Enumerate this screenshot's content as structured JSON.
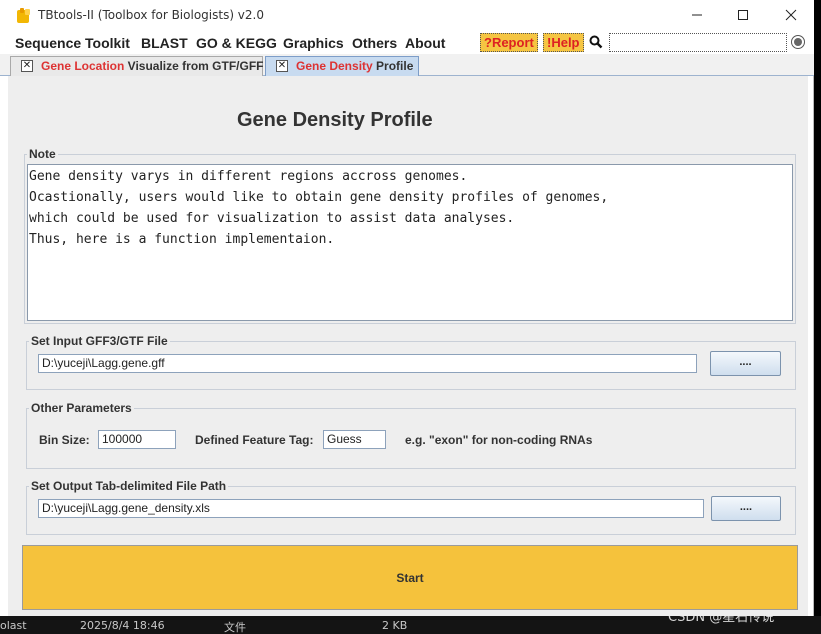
{
  "window": {
    "title": "TBtools-II (Toolbox for Biologists) v2.0",
    "icon": "tbtools-app-icon",
    "minimize_label": "—",
    "maximize_label": "☐",
    "close_label": "✕"
  },
  "menubar": {
    "items": [
      "Sequence Toolkit",
      "BLAST",
      "GO & KEGG",
      "Graphics",
      "Others",
      "About"
    ],
    "report_label": "?Report",
    "help_label": "!Help",
    "search_icon": "search-icon",
    "search_value": ""
  },
  "tabs": [
    {
      "red": "Gene Location",
      "dark": " Visualize from GTF/GFF",
      "active": false
    },
    {
      "red": "Gene Density",
      "dark": " Profile",
      "active": true
    }
  ],
  "page": {
    "heading": "Gene Density Profile",
    "note": {
      "label": "Note",
      "lines": [
        "Gene density varys in different regions accross genomes.",
        "Ocastionally, users would like to obtain gene density profiles of genomes,",
        "which could be used for visualization to assist data analyses.",
        "Thus, here is a function implementaion."
      ]
    },
    "input": {
      "label": "Set Input GFF3/GTF File",
      "value": "D:\\yuceji\\Lagg.gene.gff",
      "browse_label": "...."
    },
    "params": {
      "label": "Other Parameters",
      "bin_size_label": "Bin Size:",
      "bin_size_value": "100000",
      "feature_tag_label": "Defined Feature Tag:",
      "feature_tag_value": "Guess",
      "hint": "e.g. \"exon\" for non-coding RNAs"
    },
    "output": {
      "label": "Set Output Tab-delimited File Path",
      "value": "D:\\yuceji\\Lagg.gene_density.xls",
      "browse_label": "...."
    },
    "start_label": "Start"
  },
  "desktop": {
    "row_text": [
      "olast",
      "2025/8/4 18:46",
      "文件",
      "2 KB"
    ],
    "watermark": "CSDN @星石传说"
  },
  "colors": {
    "accent_yellow": "#f5c23c",
    "tab_red": "#dd3333",
    "active_tab": "#c8dbf0"
  }
}
